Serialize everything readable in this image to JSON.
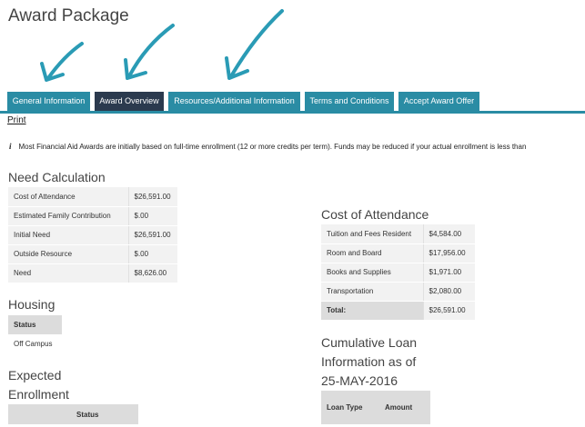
{
  "page": {
    "title": "Award Package"
  },
  "tabs": [
    {
      "label": "General Information",
      "active": false
    },
    {
      "label": "Award Overview",
      "active": true
    },
    {
      "label": "Resources/Additional Information",
      "active": false
    },
    {
      "label": "Terms and Conditions",
      "active": false
    },
    {
      "label": "Accept Award Offer",
      "active": false
    }
  ],
  "print_label": "Print",
  "notice": {
    "icon": "info-icon",
    "text": "Most Financial Aid Awards are initially based on full-time enrollment (12 or more credits per term). Funds may be reduced if your actual enrollment is less than"
  },
  "need_calculation": {
    "title": "Need Calculation",
    "rows": [
      {
        "label": "Cost of Attendance",
        "value": "$26,591.00"
      },
      {
        "label": "Estimated Family Contribution",
        "value": "$.00"
      },
      {
        "label": "Initial Need",
        "value": "$26,591.00"
      },
      {
        "label": "Outside Resource",
        "value": "$.00"
      },
      {
        "label": "Need",
        "value": "$8,626.00"
      }
    ]
  },
  "housing": {
    "title": "Housing",
    "header": "Status",
    "value": "Off Campus"
  },
  "expected_enrollment": {
    "title_line1": "Expected",
    "title_line2": "Enrollment",
    "header_status": "Status"
  },
  "cost_of_attendance": {
    "title": "Cost of Attendance",
    "rows": [
      {
        "label": "Tuition and Fees Resident",
        "value": "$4,584.00"
      },
      {
        "label": "Room and Board",
        "value": "$17,956.00"
      },
      {
        "label": "Books and Supplies",
        "value": "$1,971.00"
      },
      {
        "label": "Transportation",
        "value": "$2,080.00"
      }
    ],
    "total_label": "Total:",
    "total_value": "$26,591.00"
  },
  "cumulative_loan": {
    "title_line1": "Cumulative Loan",
    "title_line2": "Information as of",
    "title_line3": "25-MAY-2016",
    "header_loan_type": "Loan Type",
    "header_amount": "Amount"
  },
  "colors": {
    "tab": "#2a8ca4",
    "tab_active": "#2b3a4e",
    "annotation_arrow": "#2a9bb5"
  }
}
